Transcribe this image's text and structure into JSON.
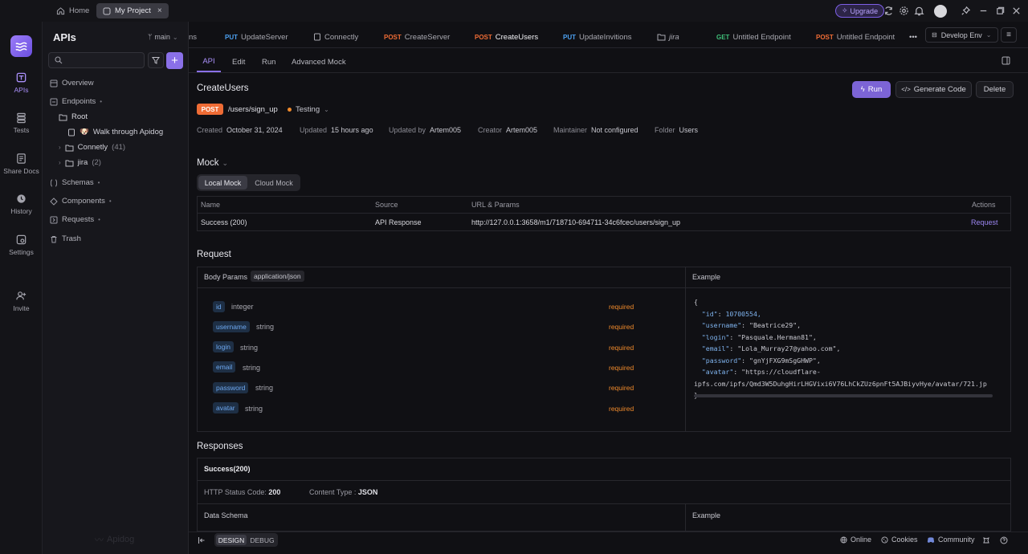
{
  "titlebar": {
    "home_label": "Home",
    "project_tab_label": "My Project",
    "upgrade_label": "Upgrade"
  },
  "rail": {
    "items": [
      {
        "label": "APIs"
      },
      {
        "label": "Tests"
      },
      {
        "label": "Share Docs"
      },
      {
        "label": "History"
      },
      {
        "label": "Settings"
      },
      {
        "label": "Invite"
      }
    ]
  },
  "sidebar": {
    "title": "APIs",
    "branch": "main",
    "tree": {
      "overview": "Overview",
      "endpoints": "Endpoints",
      "root": "Root",
      "walk_through": "Walk through Apidog",
      "connetly": "Connetly",
      "connetly_count": "(41)",
      "jira": "jira",
      "jira_count": "(2)",
      "schemas": "Schemas",
      "components": "Components",
      "requests": "Requests",
      "trash": "Trash"
    },
    "brand": "Apidog"
  },
  "tabs": {
    "items": [
      {
        "method": "",
        "label": "ns"
      },
      {
        "method": "PUT",
        "label": "UpdateServer"
      },
      {
        "method": "",
        "label": "Connectly"
      },
      {
        "method": "POST",
        "label": "CreateServer"
      },
      {
        "method": "POST",
        "label": "CreateUsers"
      },
      {
        "method": "PUT",
        "label": "UpdateInvitions"
      },
      {
        "method": "",
        "label": "jira"
      },
      {
        "method": "GET",
        "label": "Untitled Endpoint"
      },
      {
        "method": "POST",
        "label": "Untitled Endpoint"
      }
    ],
    "env_label": "Develop Env"
  },
  "subtabs": [
    "API",
    "Edit",
    "Run",
    "Advanced Mock"
  ],
  "endpoint": {
    "name": "CreateUsers",
    "method": "POST",
    "path": "/users/sign_up",
    "status": "Testing",
    "buttons": {
      "run": "Run",
      "generate": "Generate Code",
      "delete": "Delete"
    },
    "meta": {
      "created_k": "Created",
      "created_v": "October 31, 2024",
      "updated_k": "Updated",
      "updated_v": "15 hours ago",
      "updated_by_k": "Updated by",
      "updated_by_v": "Artem005",
      "creator_k": "Creator",
      "creator_v": "Artem005",
      "maintainer_k": "Maintainer",
      "maintainer_v": "Not configured",
      "folder_k": "Folder",
      "folder_v": "Users"
    }
  },
  "mock": {
    "title": "Mock",
    "local": "Local Mock",
    "cloud": "Cloud Mock",
    "headers": {
      "name": "Name",
      "source": "Source",
      "url": "URL & Params",
      "actions": "Actions"
    },
    "row": {
      "name": "Success (200)",
      "source": "API Response",
      "url": "http://127.0.0.1:3658/m1/718710-694711-34c6fcec/users/sign_up",
      "action": "Request"
    }
  },
  "request": {
    "title": "Request",
    "body_label": "Body Params",
    "content_type": "application/json",
    "example_label": "Example",
    "params": [
      {
        "name": "id",
        "type": "integer",
        "req": "required"
      },
      {
        "name": "username",
        "type": "string",
        "req": "required"
      },
      {
        "name": "login",
        "type": "string",
        "req": "required"
      },
      {
        "name": "email",
        "type": "string",
        "req": "required"
      },
      {
        "name": "password",
        "type": "string",
        "req": "required"
      },
      {
        "name": "avatar",
        "type": "string",
        "req": "required"
      }
    ],
    "example": {
      "open": "{",
      "close": "}",
      "lines": [
        {
          "k": "\"id\"",
          "v": "10700554,"
        },
        {
          "k": "\"username\"",
          "v": "\"Beatrice29\","
        },
        {
          "k": "\"login\"",
          "v": "\"Pasquale.Herman81\","
        },
        {
          "k": "\"email\"",
          "v": "\"Lola_Murray27@yahoo.com\","
        },
        {
          "k": "\"password\"",
          "v": "\"gnYjFXG9mSgGHWP\","
        },
        {
          "k": "\"avatar\"",
          "v": "\"https://cloudflare-"
        }
      ],
      "wrap": "ipfs.com/ipfs/Qmd3W5DuhgHirLHGVixi6V76LhCkZUz6pnFt5AJBiyvHye/avatar/721.jp"
    }
  },
  "responses": {
    "title": "Responses",
    "tab": "Success(200)",
    "status_k": "HTTP Status Code:",
    "status_v": "200",
    "ctype_k": "Content Type :",
    "ctype_v": "JSON",
    "schema_label": "Data Schema",
    "example_label": "Example"
  },
  "bottom": {
    "design": "DESIGN",
    "debug": "DEBUG",
    "online": "Online",
    "cookies": "Cookies",
    "community": "Community"
  }
}
